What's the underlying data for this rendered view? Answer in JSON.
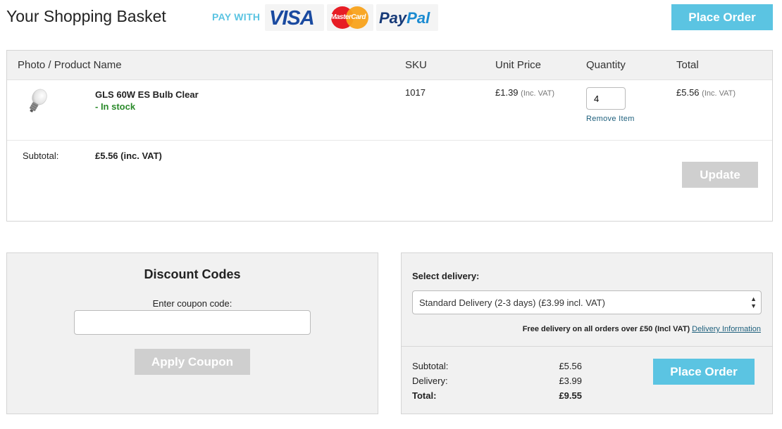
{
  "header": {
    "title": "Your Shopping Basket",
    "pay_with": "PAY WITH",
    "logos": {
      "visa": "VISA",
      "mastercard": "MasterCard",
      "paypal_a": "Pay",
      "paypal_b": "Pal"
    },
    "place_order": "Place Order"
  },
  "table": {
    "headers": [
      "Photo / Product Name",
      "SKU",
      "Unit Price",
      "Quantity",
      "Total"
    ],
    "item": {
      "icon": "light-bulb-icon",
      "name": "GLS 60W ES Bulb Clear",
      "stock": "- In stock",
      "sku": "1017",
      "unit_price": "£1.39",
      "unit_price_vat": "(Inc. VAT)",
      "quantity": "4",
      "remove": "Remove Item",
      "total": "£5.56",
      "total_vat": "(Inc. VAT)"
    },
    "subtotal_label": "Subtotal:",
    "subtotal_value": "£5.56 (inc. VAT)",
    "update": "Update"
  },
  "discount": {
    "title": "Discount Codes",
    "label": "Enter coupon code:",
    "value": "",
    "apply": "Apply Coupon"
  },
  "delivery": {
    "label": "Select delivery:",
    "selected": "Standard Delivery (2-3 days) (£3.99 incl. VAT)",
    "free_note": "Free delivery on all orders over £50 (Incl VAT)",
    "info_link": "Delivery Information",
    "subtotal_label": "Subtotal:",
    "subtotal_value": "£5.56",
    "delivery_label": "Delivery:",
    "delivery_value": "£3.99",
    "total_label": "Total:",
    "total_value": "£9.55",
    "place_order": "Place Order"
  },
  "colors": {
    "accent": "#5bc4e2",
    "disabled": "#cfcfcf",
    "stock": "#2a8a2a",
    "link": "#1d5f7c"
  }
}
